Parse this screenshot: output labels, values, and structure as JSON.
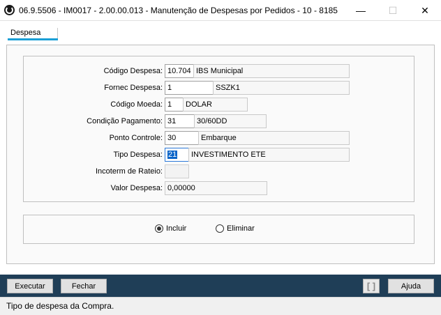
{
  "window": {
    "title": "06.9.5506 - IM0017 - 2.00.00.013 - Manutenção de Despesas por Pedidos - 10 - 8185",
    "minimize": "—",
    "maximize": "☐",
    "close": "✕"
  },
  "tabs": [
    {
      "label": "Despesa"
    }
  ],
  "form": {
    "codigo_despesa": {
      "label": "Código Despesa:",
      "value": "10.704",
      "desc": "IBS Municipal"
    },
    "fornec_despesa": {
      "label": "Fornec Despesa:",
      "value": "1",
      "desc": "SSZK1"
    },
    "codigo_moeda": {
      "label": "Código Moeda:",
      "value": "1",
      "desc": "DOLAR"
    },
    "condicao_pagamento": {
      "label": "Condição Pagamento:",
      "value": "31",
      "desc": "30/60DD"
    },
    "ponto_controle": {
      "label": "Ponto Controle:",
      "value": "30",
      "desc": "Embarque"
    },
    "tipo_despesa": {
      "label": "Tipo Despesa:",
      "value": "21",
      "desc": "INVESTIMENTO ETE"
    },
    "incoterm_rateio": {
      "label": "Incoterm de Rateio:",
      "value": ""
    },
    "valor_despesa": {
      "label": "Valor Despesa:",
      "value": "0,00000"
    }
  },
  "options": {
    "incluir": "Incluir",
    "eliminar": "Eliminar",
    "selected": "incluir"
  },
  "footer": {
    "executar": "Executar",
    "fechar": "Fechar",
    "ajuda": "Ajuda",
    "bracket_icon": "[ ]"
  },
  "status": "Tipo de despesa da Compra.",
  "colors": {
    "footer_bg": "#1f3e57",
    "tab_accent": "#1a9fd6",
    "selection": "#0a64c8"
  }
}
